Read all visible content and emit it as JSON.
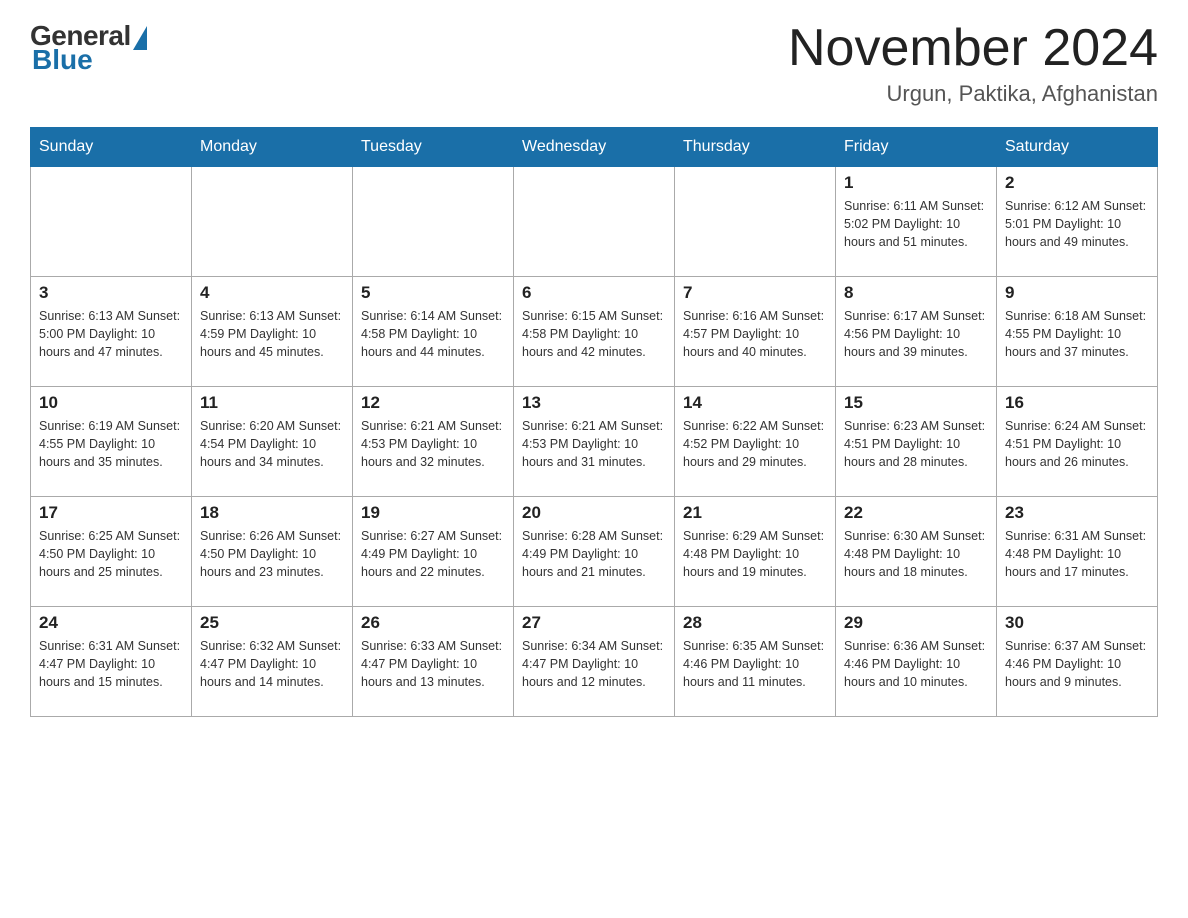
{
  "header": {
    "logo": {
      "general": "General",
      "blue": "Blue"
    },
    "title": "November 2024",
    "location": "Urgun, Paktika, Afghanistan"
  },
  "calendar": {
    "days_of_week": [
      "Sunday",
      "Monday",
      "Tuesday",
      "Wednesday",
      "Thursday",
      "Friday",
      "Saturday"
    ],
    "weeks": [
      [
        {
          "day": "",
          "info": ""
        },
        {
          "day": "",
          "info": ""
        },
        {
          "day": "",
          "info": ""
        },
        {
          "day": "",
          "info": ""
        },
        {
          "day": "",
          "info": ""
        },
        {
          "day": "1",
          "info": "Sunrise: 6:11 AM\nSunset: 5:02 PM\nDaylight: 10 hours\nand 51 minutes."
        },
        {
          "day": "2",
          "info": "Sunrise: 6:12 AM\nSunset: 5:01 PM\nDaylight: 10 hours\nand 49 minutes."
        }
      ],
      [
        {
          "day": "3",
          "info": "Sunrise: 6:13 AM\nSunset: 5:00 PM\nDaylight: 10 hours\nand 47 minutes."
        },
        {
          "day": "4",
          "info": "Sunrise: 6:13 AM\nSunset: 4:59 PM\nDaylight: 10 hours\nand 45 minutes."
        },
        {
          "day": "5",
          "info": "Sunrise: 6:14 AM\nSunset: 4:58 PM\nDaylight: 10 hours\nand 44 minutes."
        },
        {
          "day": "6",
          "info": "Sunrise: 6:15 AM\nSunset: 4:58 PM\nDaylight: 10 hours\nand 42 minutes."
        },
        {
          "day": "7",
          "info": "Sunrise: 6:16 AM\nSunset: 4:57 PM\nDaylight: 10 hours\nand 40 minutes."
        },
        {
          "day": "8",
          "info": "Sunrise: 6:17 AM\nSunset: 4:56 PM\nDaylight: 10 hours\nand 39 minutes."
        },
        {
          "day": "9",
          "info": "Sunrise: 6:18 AM\nSunset: 4:55 PM\nDaylight: 10 hours\nand 37 minutes."
        }
      ],
      [
        {
          "day": "10",
          "info": "Sunrise: 6:19 AM\nSunset: 4:55 PM\nDaylight: 10 hours\nand 35 minutes."
        },
        {
          "day": "11",
          "info": "Sunrise: 6:20 AM\nSunset: 4:54 PM\nDaylight: 10 hours\nand 34 minutes."
        },
        {
          "day": "12",
          "info": "Sunrise: 6:21 AM\nSunset: 4:53 PM\nDaylight: 10 hours\nand 32 minutes."
        },
        {
          "day": "13",
          "info": "Sunrise: 6:21 AM\nSunset: 4:53 PM\nDaylight: 10 hours\nand 31 minutes."
        },
        {
          "day": "14",
          "info": "Sunrise: 6:22 AM\nSunset: 4:52 PM\nDaylight: 10 hours\nand 29 minutes."
        },
        {
          "day": "15",
          "info": "Sunrise: 6:23 AM\nSunset: 4:51 PM\nDaylight: 10 hours\nand 28 minutes."
        },
        {
          "day": "16",
          "info": "Sunrise: 6:24 AM\nSunset: 4:51 PM\nDaylight: 10 hours\nand 26 minutes."
        }
      ],
      [
        {
          "day": "17",
          "info": "Sunrise: 6:25 AM\nSunset: 4:50 PM\nDaylight: 10 hours\nand 25 minutes."
        },
        {
          "day": "18",
          "info": "Sunrise: 6:26 AM\nSunset: 4:50 PM\nDaylight: 10 hours\nand 23 minutes."
        },
        {
          "day": "19",
          "info": "Sunrise: 6:27 AM\nSunset: 4:49 PM\nDaylight: 10 hours\nand 22 minutes."
        },
        {
          "day": "20",
          "info": "Sunrise: 6:28 AM\nSunset: 4:49 PM\nDaylight: 10 hours\nand 21 minutes."
        },
        {
          "day": "21",
          "info": "Sunrise: 6:29 AM\nSunset: 4:48 PM\nDaylight: 10 hours\nand 19 minutes."
        },
        {
          "day": "22",
          "info": "Sunrise: 6:30 AM\nSunset: 4:48 PM\nDaylight: 10 hours\nand 18 minutes."
        },
        {
          "day": "23",
          "info": "Sunrise: 6:31 AM\nSunset: 4:48 PM\nDaylight: 10 hours\nand 17 minutes."
        }
      ],
      [
        {
          "day": "24",
          "info": "Sunrise: 6:31 AM\nSunset: 4:47 PM\nDaylight: 10 hours\nand 15 minutes."
        },
        {
          "day": "25",
          "info": "Sunrise: 6:32 AM\nSunset: 4:47 PM\nDaylight: 10 hours\nand 14 minutes."
        },
        {
          "day": "26",
          "info": "Sunrise: 6:33 AM\nSunset: 4:47 PM\nDaylight: 10 hours\nand 13 minutes."
        },
        {
          "day": "27",
          "info": "Sunrise: 6:34 AM\nSunset: 4:47 PM\nDaylight: 10 hours\nand 12 minutes."
        },
        {
          "day": "28",
          "info": "Sunrise: 6:35 AM\nSunset: 4:46 PM\nDaylight: 10 hours\nand 11 minutes."
        },
        {
          "day": "29",
          "info": "Sunrise: 6:36 AM\nSunset: 4:46 PM\nDaylight: 10 hours\nand 10 minutes."
        },
        {
          "day": "30",
          "info": "Sunrise: 6:37 AM\nSunset: 4:46 PM\nDaylight: 10 hours\nand 9 minutes."
        }
      ]
    ]
  }
}
